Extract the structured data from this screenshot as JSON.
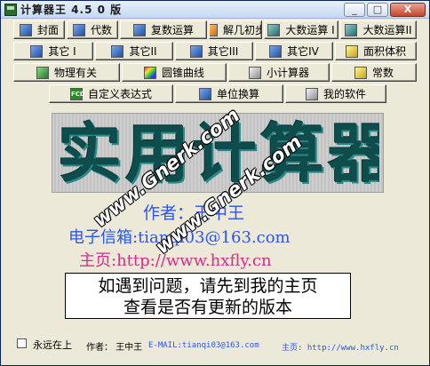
{
  "window": {
    "title": "计算器王 4.5 0 版"
  },
  "window_buttons": {
    "minimize": "_",
    "maximize": "□",
    "close": "X"
  },
  "toolbar": {
    "row1": [
      {
        "label": "封面",
        "icon": "cover-icon"
      },
      {
        "label": "代数",
        "icon": "algebra-icon"
      },
      {
        "label": "复数运算",
        "icon": "complex-icon"
      },
      {
        "label": "解几初步",
        "icon": "geometry-icon"
      },
      {
        "label": "大数运算 I",
        "icon": "bignum1-icon"
      },
      {
        "label": "大数运算II",
        "icon": "bignum2-icon"
      }
    ],
    "row2": [
      {
        "label": "其它 I",
        "icon": "other1-icon"
      },
      {
        "label": "其它II",
        "icon": "other2-icon"
      },
      {
        "label": "其它III",
        "icon": "other3-icon"
      },
      {
        "label": "其它IV",
        "icon": "other4-icon"
      },
      {
        "label": "面积体积",
        "icon": "area-volume-icon"
      }
    ],
    "row3": [
      {
        "label": "物理有关",
        "icon": "physics-icon"
      },
      {
        "label": "圆锥曲线",
        "icon": "conic-icon"
      },
      {
        "label": "小计算器",
        "icon": "mini-calc-icon"
      },
      {
        "label": "常数",
        "icon": "constant-icon"
      }
    ],
    "row4": [
      {
        "label": "自定义表达式",
        "icon": "fcd-icon",
        "icon_text": "FCD"
      },
      {
        "label": "单位换算",
        "icon": "unit-icon"
      },
      {
        "label": "我的软件",
        "icon": "help-icon"
      }
    ]
  },
  "banner": {
    "title": "实用计算器"
  },
  "info": {
    "author": "作者：王中王",
    "email": "电子信箱:tianqi03@163.com",
    "site": "主页:http://www.hxfly.cn"
  },
  "notice": {
    "line1": "如遇到问题，请先到我的主页",
    "line2": "查看是否有更新的版本"
  },
  "watermarks": [
    "www.Gnerk.com",
    "www.Gnerk.com"
  ],
  "status": {
    "always_on_top": "永远在上",
    "author": "作者： 王中王",
    "email": "E-MAIL:tianqi03@163.com",
    "homepage": "主页: http://www.hxfly.cn"
  },
  "colors": {
    "info_blue": "#2d55e8",
    "site_magenta": "#d62e8a",
    "banner_teal": "#0f4c4c"
  }
}
